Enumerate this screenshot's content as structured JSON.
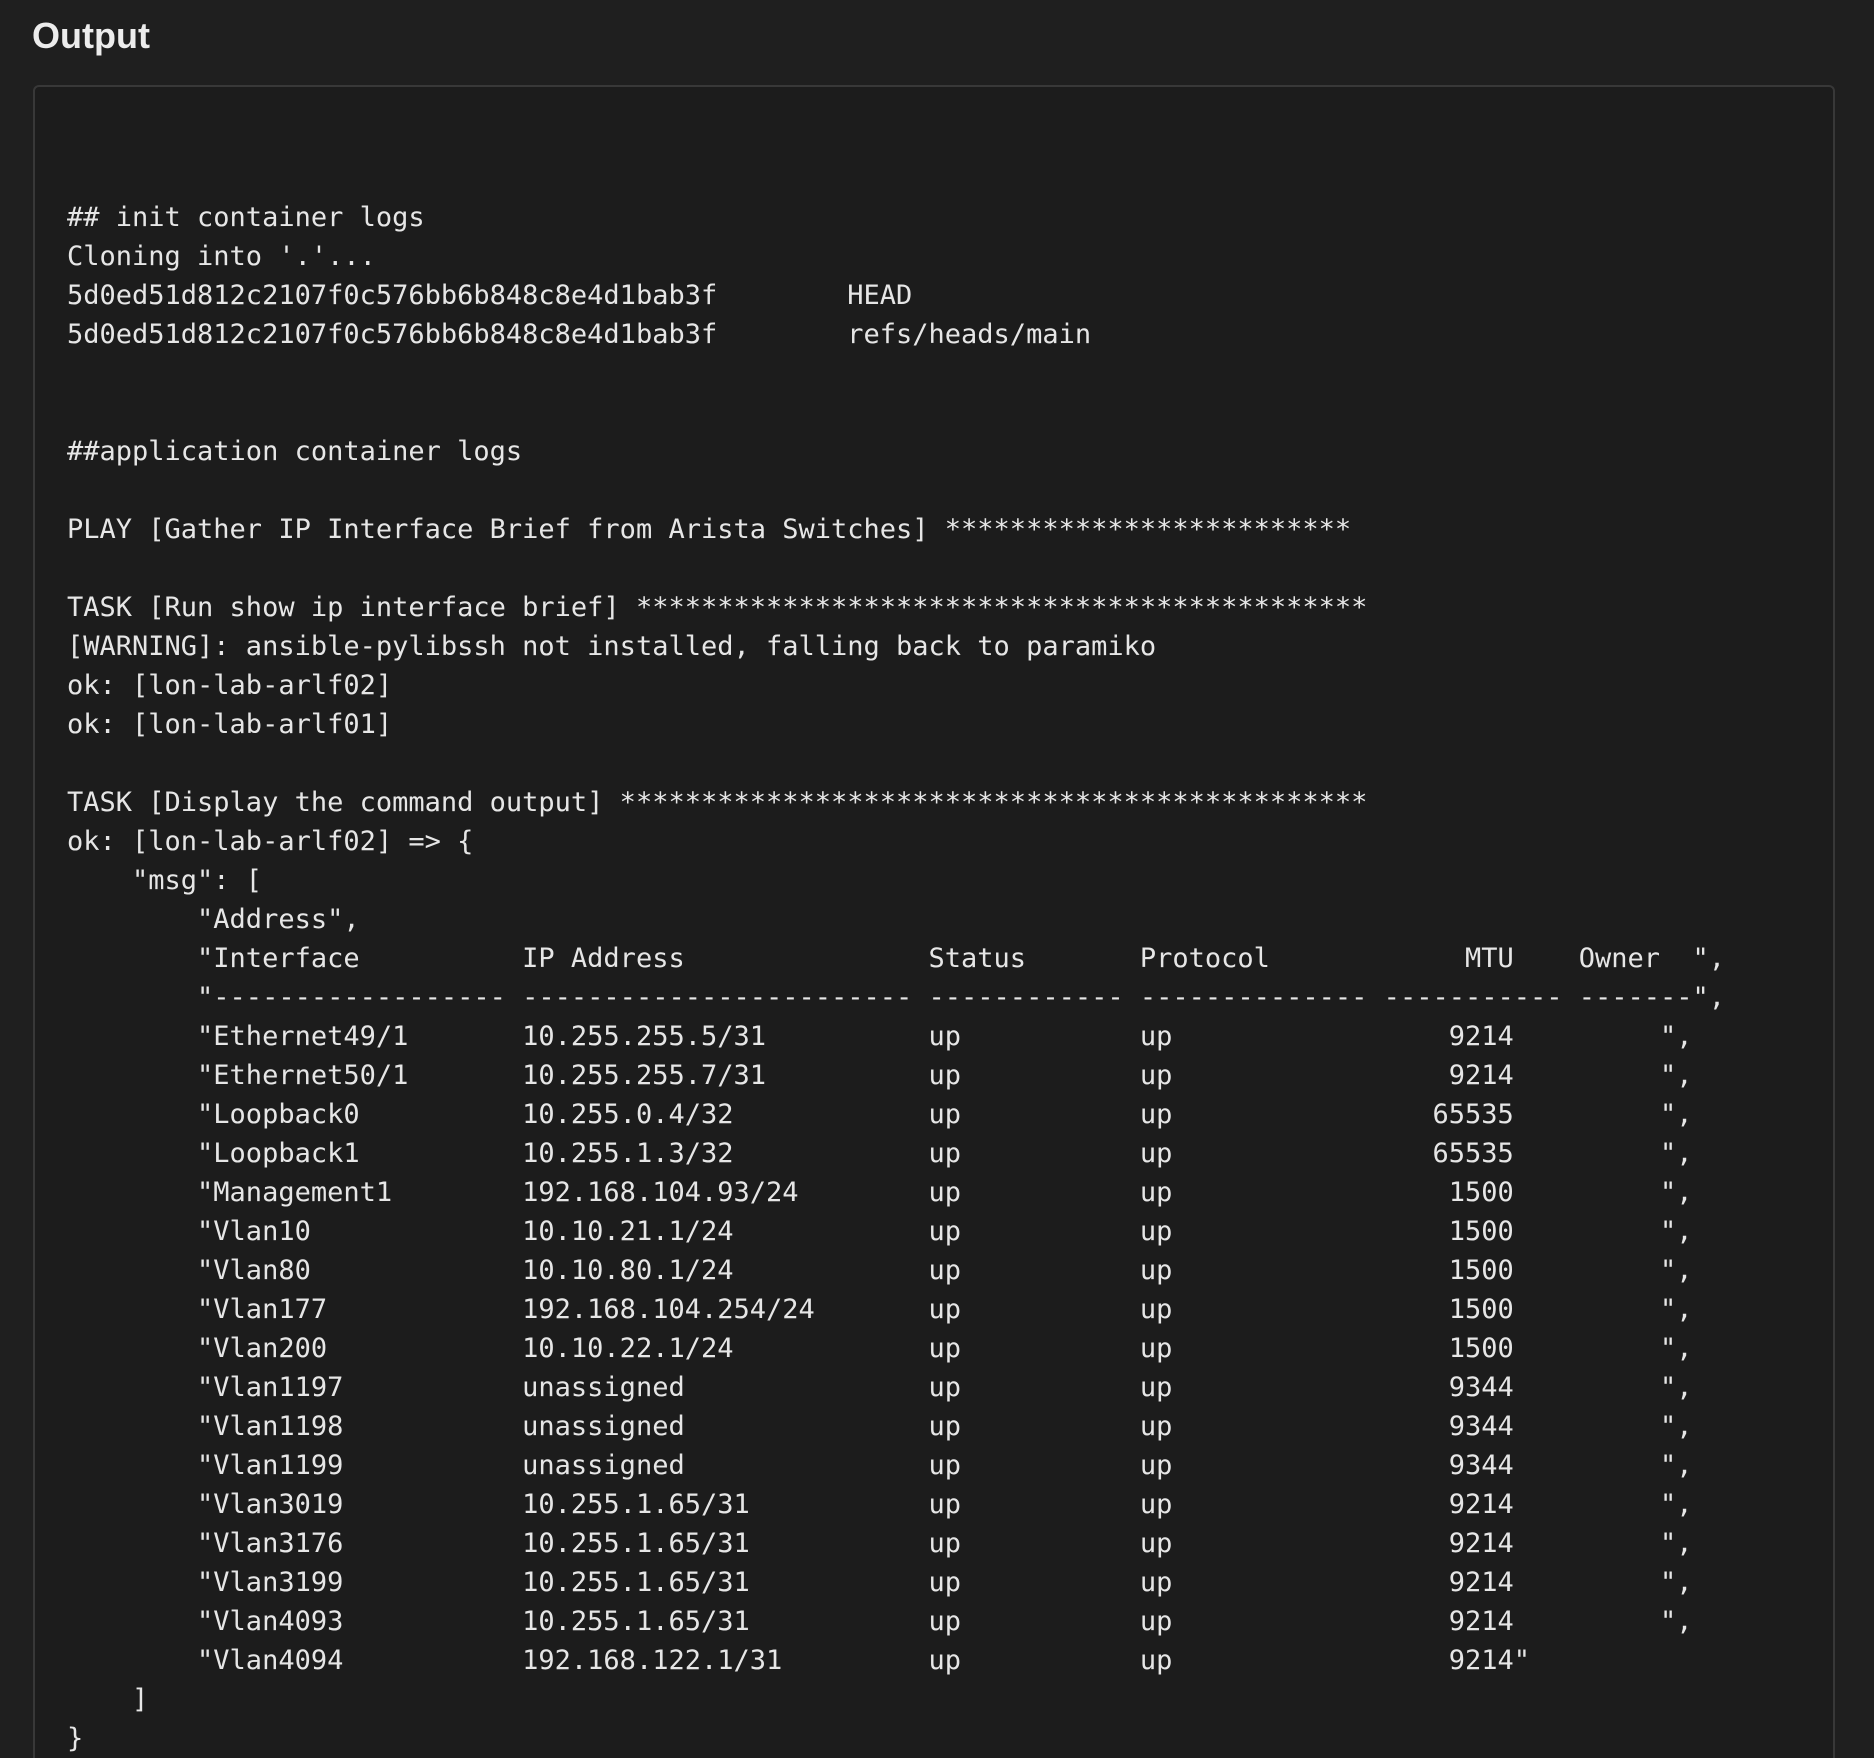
{
  "output_section": {
    "title": "Output",
    "log_lines": [
      "## init container logs",
      "Cloning into '.'...",
      "5d0ed51d812c2107f0c576bb6b848c8e4d1bab3f        HEAD",
      "5d0ed51d812c2107f0c576bb6b848c8e4d1bab3f        refs/heads/main",
      "",
      "",
      "##application container logs",
      "",
      "PLAY [Gather IP Interface Brief from Arista Switches] *************************",
      "",
      "TASK [Run show ip interface brief] *********************************************",
      "[WARNING]: ansible-pylibssh not installed, falling back to paramiko",
      "ok: [lon-lab-arlf02]",
      "ok: [lon-lab-arlf01]",
      "",
      "TASK [Display the command output] **********************************************",
      "ok: [lon-lab-arlf02] => {",
      "    \"msg\": [",
      "        \"Address\",",
      "        \"Interface          IP Address               Status       Protocol            MTU    Owner  \",",
      "        \"------------------ ------------------------ ------------ -------------- ----------- -------\",",
      "        \"Ethernet49/1       10.255.255.5/31          up           up                 9214         \",",
      "        \"Ethernet50/1       10.255.255.7/31          up           up                 9214         \",",
      "        \"Loopback0          10.255.0.4/32            up           up                65535         \",",
      "        \"Loopback1          10.255.1.3/32            up           up                65535         \",",
      "        \"Management1        192.168.104.93/24        up           up                 1500         \",",
      "        \"Vlan10             10.10.21.1/24            up           up                 1500         \",",
      "        \"Vlan80             10.10.80.1/24            up           up                 1500         \",",
      "        \"Vlan177            192.168.104.254/24       up           up                 1500         \",",
      "        \"Vlan200            10.10.22.1/24            up           up                 1500         \",",
      "        \"Vlan1197           unassigned               up           up                 9344         \",",
      "        \"Vlan1198           unassigned               up           up                 9344         \",",
      "        \"Vlan1199           unassigned               up           up                 9344         \",",
      "        \"Vlan3019           10.255.1.65/31           up           up                 9214         \",",
      "        \"Vlan3176           10.255.1.65/31           up           up                 9214         \",",
      "        \"Vlan3199           10.255.1.65/31           up           up                 9214         \",",
      "        \"Vlan4093           10.255.1.65/31           up           up                 9214         \",",
      "        \"Vlan4094           192.168.122.1/31         up           up                 9214\"",
      "    ]",
      "}"
    ]
  }
}
